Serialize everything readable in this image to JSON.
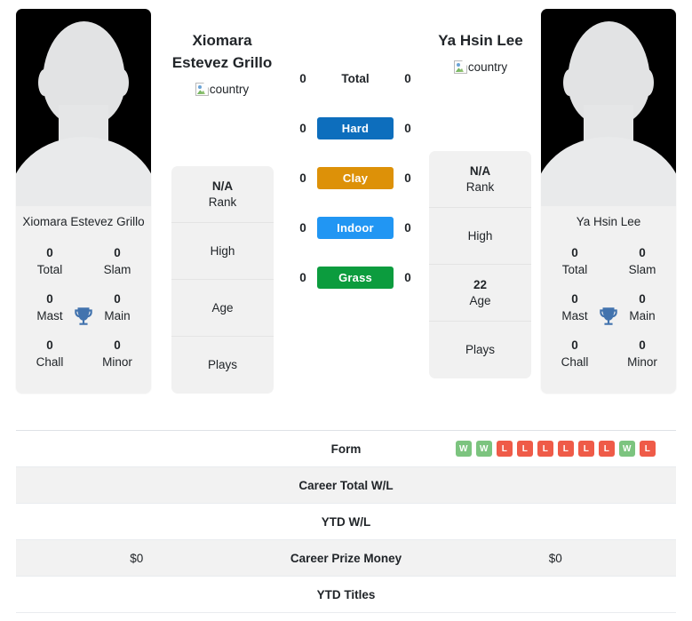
{
  "players": {
    "left": {
      "display_name_line1": "Xiomara",
      "display_name_line2": "Estevez Grillo",
      "country_alt": "country",
      "card_name": "Xiomara Estevez Grillo",
      "titles": [
        {
          "value": "0",
          "label": "Total"
        },
        {
          "value": "0",
          "label": "Slam"
        },
        {
          "value": "0",
          "label": "Mast"
        },
        {
          "value": "0",
          "label": "Main"
        },
        {
          "value": "0",
          "label": "Chall"
        },
        {
          "value": "0",
          "label": "Minor"
        }
      ],
      "info": [
        {
          "value": "N/A",
          "label": "Rank"
        },
        {
          "value": "",
          "label": "High"
        },
        {
          "value": "",
          "label": "Age"
        },
        {
          "value": "",
          "label": "Plays"
        }
      ]
    },
    "right": {
      "display_name_line1": "Ya Hsin Lee",
      "display_name_line2": "",
      "country_alt": "country",
      "card_name": "Ya Hsin Lee",
      "titles": [
        {
          "value": "0",
          "label": "Total"
        },
        {
          "value": "0",
          "label": "Slam"
        },
        {
          "value": "0",
          "label": "Mast"
        },
        {
          "value": "0",
          "label": "Main"
        },
        {
          "value": "0",
          "label": "Chall"
        },
        {
          "value": "0",
          "label": "Minor"
        }
      ],
      "info": [
        {
          "value": "N/A",
          "label": "Rank"
        },
        {
          "value": "",
          "label": "High"
        },
        {
          "value": "22",
          "label": "Age"
        },
        {
          "value": "",
          "label": "Plays"
        }
      ]
    }
  },
  "surfaces": [
    {
      "label": "Total",
      "left": "0",
      "right": "0",
      "color": null
    },
    {
      "label": "Hard",
      "left": "0",
      "right": "0",
      "color": "#0d6ebd"
    },
    {
      "label": "Clay",
      "left": "0",
      "right": "0",
      "color": "#dd9108"
    },
    {
      "label": "Indoor",
      "left": "0",
      "right": "0",
      "color": "#2196f3"
    },
    {
      "label": "Grass",
      "left": "0",
      "right": "0",
      "color": "#0c9c3e"
    }
  ],
  "table": {
    "rows": [
      {
        "label": "Form",
        "left": "",
        "right": "",
        "right_badges": [
          "W",
          "W",
          "L",
          "L",
          "L",
          "L",
          "L",
          "L",
          "W",
          "L"
        ]
      },
      {
        "label": "Career Total W/L",
        "left": "",
        "right": ""
      },
      {
        "label": "YTD W/L",
        "left": "",
        "right": ""
      },
      {
        "label": "Career Prize Money",
        "left": "$0",
        "right": "$0"
      },
      {
        "label": "YTD Titles",
        "left": "",
        "right": ""
      }
    ]
  },
  "colors": {
    "card_bg": "#f1f1f1",
    "trophy": "#4273ae",
    "win": "#7cc47f",
    "loss": "#ef5b48"
  }
}
